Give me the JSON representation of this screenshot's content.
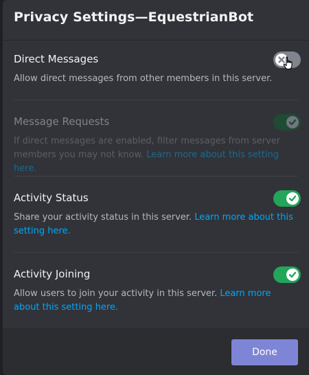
{
  "modal": {
    "title": "Privacy Settings—EquestrianBot"
  },
  "settings": [
    {
      "title": "Direct Messages",
      "description": "Allow direct messages from other members in this server.",
      "link": "",
      "state": "off"
    },
    {
      "title": "Message Requests",
      "description": "If direct messages are enabled, filter messages from server members you may not know. ",
      "link": "Learn more about this setting here.",
      "state": "on-disabled"
    },
    {
      "title": "Activity Status",
      "description": "Share your activity status in this server. ",
      "link": "Learn more about this setting here.",
      "state": "on"
    },
    {
      "title": "Activity Joining",
      "description": "Allow users to join your activity in this server. ",
      "link": "Learn more about this setting here.",
      "state": "on"
    }
  ],
  "footer": {
    "done_label": "Done"
  },
  "colors": {
    "toggle_on": "#23a55a",
    "toggle_off": "#80848e",
    "link": "#00a8fc",
    "primary_button": "#7e85d6"
  },
  "icons": {
    "toggle_on": "check-icon",
    "toggle_off": "x-icon",
    "cursor": "hand-pointer-icon"
  }
}
